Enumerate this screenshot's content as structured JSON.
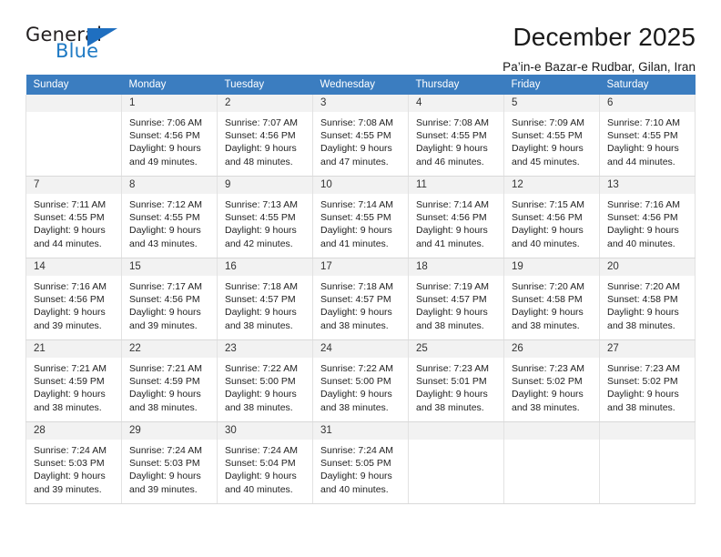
{
  "logo": {
    "word_top": "General",
    "word_bottom": "Blue",
    "triangle_color": "#1f6fc0",
    "blue_color": "#1f7ac4"
  },
  "header": {
    "title": "December 2025",
    "subtitle": "Pa’in-e Bazar-e Rudbar, Gilan, Iran"
  },
  "calendar": {
    "header_bg": "#3b7dc0",
    "daynum_bg": "#f2f2f2",
    "weekdays": [
      "Sunday",
      "Monday",
      "Tuesday",
      "Wednesday",
      "Thursday",
      "Friday",
      "Saturday"
    ],
    "weeks": [
      [
        {
          "day": "",
          "empty": true
        },
        {
          "day": "1",
          "sunrise": "Sunrise: 7:06 AM",
          "sunset": "Sunset: 4:56 PM",
          "daylight1": "Daylight: 9 hours",
          "daylight2": "and 49 minutes."
        },
        {
          "day": "2",
          "sunrise": "Sunrise: 7:07 AM",
          "sunset": "Sunset: 4:56 PM",
          "daylight1": "Daylight: 9 hours",
          "daylight2": "and 48 minutes."
        },
        {
          "day": "3",
          "sunrise": "Sunrise: 7:08 AM",
          "sunset": "Sunset: 4:55 PM",
          "daylight1": "Daylight: 9 hours",
          "daylight2": "and 47 minutes."
        },
        {
          "day": "4",
          "sunrise": "Sunrise: 7:08 AM",
          "sunset": "Sunset: 4:55 PM",
          "daylight1": "Daylight: 9 hours",
          "daylight2": "and 46 minutes."
        },
        {
          "day": "5",
          "sunrise": "Sunrise: 7:09 AM",
          "sunset": "Sunset: 4:55 PM",
          "daylight1": "Daylight: 9 hours",
          "daylight2": "and 45 minutes."
        },
        {
          "day": "6",
          "sunrise": "Sunrise: 7:10 AM",
          "sunset": "Sunset: 4:55 PM",
          "daylight1": "Daylight: 9 hours",
          "daylight2": "and 44 minutes."
        }
      ],
      [
        {
          "day": "7",
          "sunrise": "Sunrise: 7:11 AM",
          "sunset": "Sunset: 4:55 PM",
          "daylight1": "Daylight: 9 hours",
          "daylight2": "and 44 minutes."
        },
        {
          "day": "8",
          "sunrise": "Sunrise: 7:12 AM",
          "sunset": "Sunset: 4:55 PM",
          "daylight1": "Daylight: 9 hours",
          "daylight2": "and 43 minutes."
        },
        {
          "day": "9",
          "sunrise": "Sunrise: 7:13 AM",
          "sunset": "Sunset: 4:55 PM",
          "daylight1": "Daylight: 9 hours",
          "daylight2": "and 42 minutes."
        },
        {
          "day": "10",
          "sunrise": "Sunrise: 7:14 AM",
          "sunset": "Sunset: 4:55 PM",
          "daylight1": "Daylight: 9 hours",
          "daylight2": "and 41 minutes."
        },
        {
          "day": "11",
          "sunrise": "Sunrise: 7:14 AM",
          "sunset": "Sunset: 4:56 PM",
          "daylight1": "Daylight: 9 hours",
          "daylight2": "and 41 minutes."
        },
        {
          "day": "12",
          "sunrise": "Sunrise: 7:15 AM",
          "sunset": "Sunset: 4:56 PM",
          "daylight1": "Daylight: 9 hours",
          "daylight2": "and 40 minutes."
        },
        {
          "day": "13",
          "sunrise": "Sunrise: 7:16 AM",
          "sunset": "Sunset: 4:56 PM",
          "daylight1": "Daylight: 9 hours",
          "daylight2": "and 40 minutes."
        }
      ],
      [
        {
          "day": "14",
          "sunrise": "Sunrise: 7:16 AM",
          "sunset": "Sunset: 4:56 PM",
          "daylight1": "Daylight: 9 hours",
          "daylight2": "and 39 minutes."
        },
        {
          "day": "15",
          "sunrise": "Sunrise: 7:17 AM",
          "sunset": "Sunset: 4:56 PM",
          "daylight1": "Daylight: 9 hours",
          "daylight2": "and 39 minutes."
        },
        {
          "day": "16",
          "sunrise": "Sunrise: 7:18 AM",
          "sunset": "Sunset: 4:57 PM",
          "daylight1": "Daylight: 9 hours",
          "daylight2": "and 38 minutes."
        },
        {
          "day": "17",
          "sunrise": "Sunrise: 7:18 AM",
          "sunset": "Sunset: 4:57 PM",
          "daylight1": "Daylight: 9 hours",
          "daylight2": "and 38 minutes."
        },
        {
          "day": "18",
          "sunrise": "Sunrise: 7:19 AM",
          "sunset": "Sunset: 4:57 PM",
          "daylight1": "Daylight: 9 hours",
          "daylight2": "and 38 minutes."
        },
        {
          "day": "19",
          "sunrise": "Sunrise: 7:20 AM",
          "sunset": "Sunset: 4:58 PM",
          "daylight1": "Daylight: 9 hours",
          "daylight2": "and 38 minutes."
        },
        {
          "day": "20",
          "sunrise": "Sunrise: 7:20 AM",
          "sunset": "Sunset: 4:58 PM",
          "daylight1": "Daylight: 9 hours",
          "daylight2": "and 38 minutes."
        }
      ],
      [
        {
          "day": "21",
          "sunrise": "Sunrise: 7:21 AM",
          "sunset": "Sunset: 4:59 PM",
          "daylight1": "Daylight: 9 hours",
          "daylight2": "and 38 minutes."
        },
        {
          "day": "22",
          "sunrise": "Sunrise: 7:21 AM",
          "sunset": "Sunset: 4:59 PM",
          "daylight1": "Daylight: 9 hours",
          "daylight2": "and 38 minutes."
        },
        {
          "day": "23",
          "sunrise": "Sunrise: 7:22 AM",
          "sunset": "Sunset: 5:00 PM",
          "daylight1": "Daylight: 9 hours",
          "daylight2": "and 38 minutes."
        },
        {
          "day": "24",
          "sunrise": "Sunrise: 7:22 AM",
          "sunset": "Sunset: 5:00 PM",
          "daylight1": "Daylight: 9 hours",
          "daylight2": "and 38 minutes."
        },
        {
          "day": "25",
          "sunrise": "Sunrise: 7:23 AM",
          "sunset": "Sunset: 5:01 PM",
          "daylight1": "Daylight: 9 hours",
          "daylight2": "and 38 minutes."
        },
        {
          "day": "26",
          "sunrise": "Sunrise: 7:23 AM",
          "sunset": "Sunset: 5:02 PM",
          "daylight1": "Daylight: 9 hours",
          "daylight2": "and 38 minutes."
        },
        {
          "day": "27",
          "sunrise": "Sunrise: 7:23 AM",
          "sunset": "Sunset: 5:02 PM",
          "daylight1": "Daylight: 9 hours",
          "daylight2": "and 38 minutes."
        }
      ],
      [
        {
          "day": "28",
          "sunrise": "Sunrise: 7:24 AM",
          "sunset": "Sunset: 5:03 PM",
          "daylight1": "Daylight: 9 hours",
          "daylight2": "and 39 minutes."
        },
        {
          "day": "29",
          "sunrise": "Sunrise: 7:24 AM",
          "sunset": "Sunset: 5:03 PM",
          "daylight1": "Daylight: 9 hours",
          "daylight2": "and 39 minutes."
        },
        {
          "day": "30",
          "sunrise": "Sunrise: 7:24 AM",
          "sunset": "Sunset: 5:04 PM",
          "daylight1": "Daylight: 9 hours",
          "daylight2": "and 40 minutes."
        },
        {
          "day": "31",
          "sunrise": "Sunrise: 7:24 AM",
          "sunset": "Sunset: 5:05 PM",
          "daylight1": "Daylight: 9 hours",
          "daylight2": "and 40 minutes."
        },
        {
          "day": "",
          "empty": true
        },
        {
          "day": "",
          "empty": true
        },
        {
          "day": "",
          "empty": true
        }
      ]
    ]
  }
}
